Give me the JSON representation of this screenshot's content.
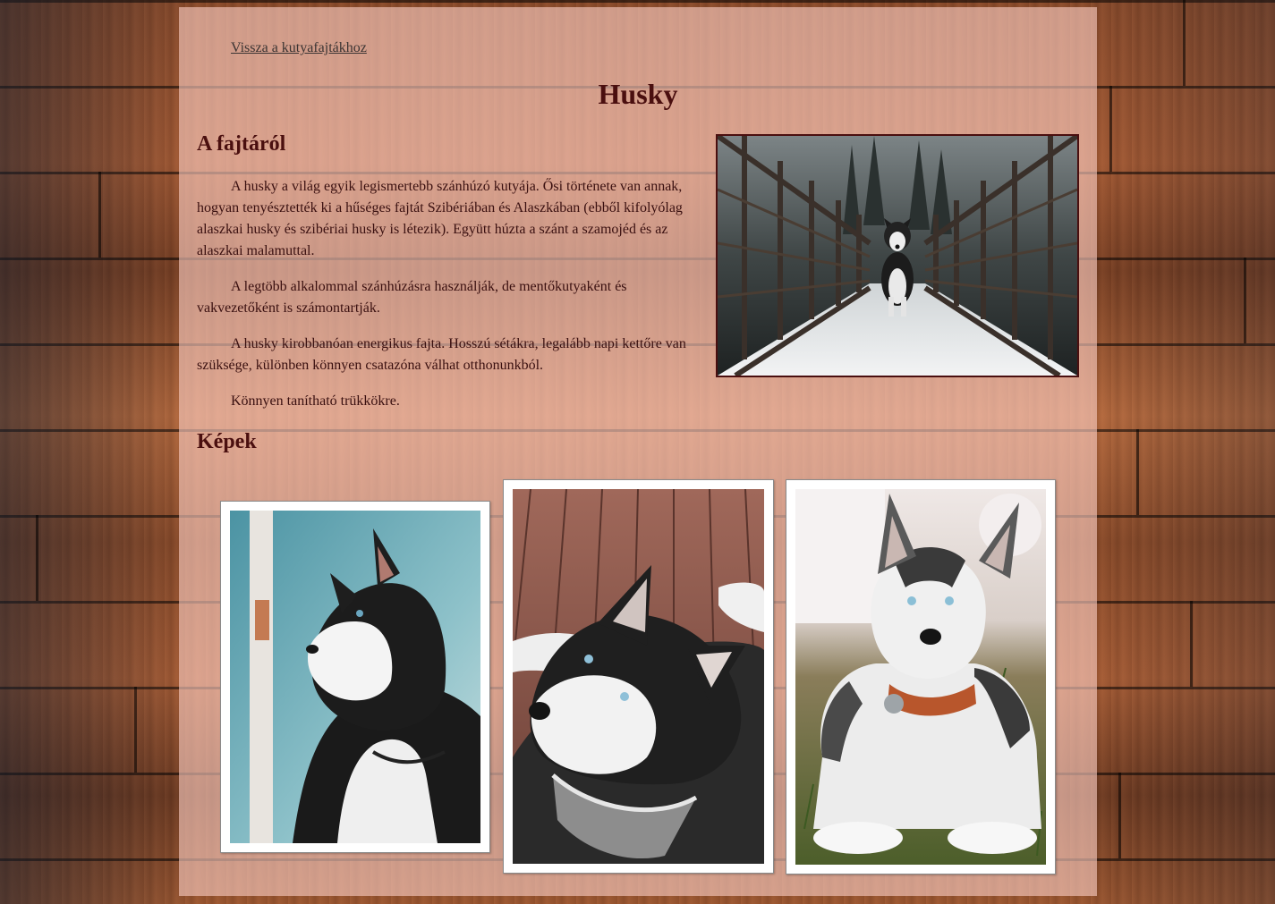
{
  "nav": {
    "back_link": "Vissza a kutyafajtákhoz"
  },
  "page": {
    "title": "Husky"
  },
  "about": {
    "heading": "A fajtáról",
    "paragraphs": [
      "A husky a világ egyik legismertebb szánhúzó kutyája. Ősi története van annak, hogyan tenyésztették ki a hűséges fajtát Szibériában és Alaszkában (ebből kifolyólag alaszkai husky és szibériai husky is létezik). Együtt húzta a szánt a szamojéd és az alaszkai malamuttal.",
      "A legtöbb alkalommal szánhúzásra használják, de mentőkutyaként és vakvezetőként is számontartják.",
      "A husky kirobbanóan energikus fajta. Hosszú sétákra, legalább napi kettőre van szüksége, különben könnyen csatazóna válhat otthonunkból.",
      "Könnyen tanítható trükkökre."
    ]
  },
  "gallery": {
    "heading": "Képek",
    "photos": [
      {
        "subject": "husky-profile-photo"
      },
      {
        "subject": "husky-on-wooden-deck-photo"
      },
      {
        "subject": "husky-puppy-on-grass-photo"
      }
    ]
  },
  "colors": {
    "heading": "#4a0f0f",
    "text": "#3a1010",
    "panel": "#facdc3"
  }
}
